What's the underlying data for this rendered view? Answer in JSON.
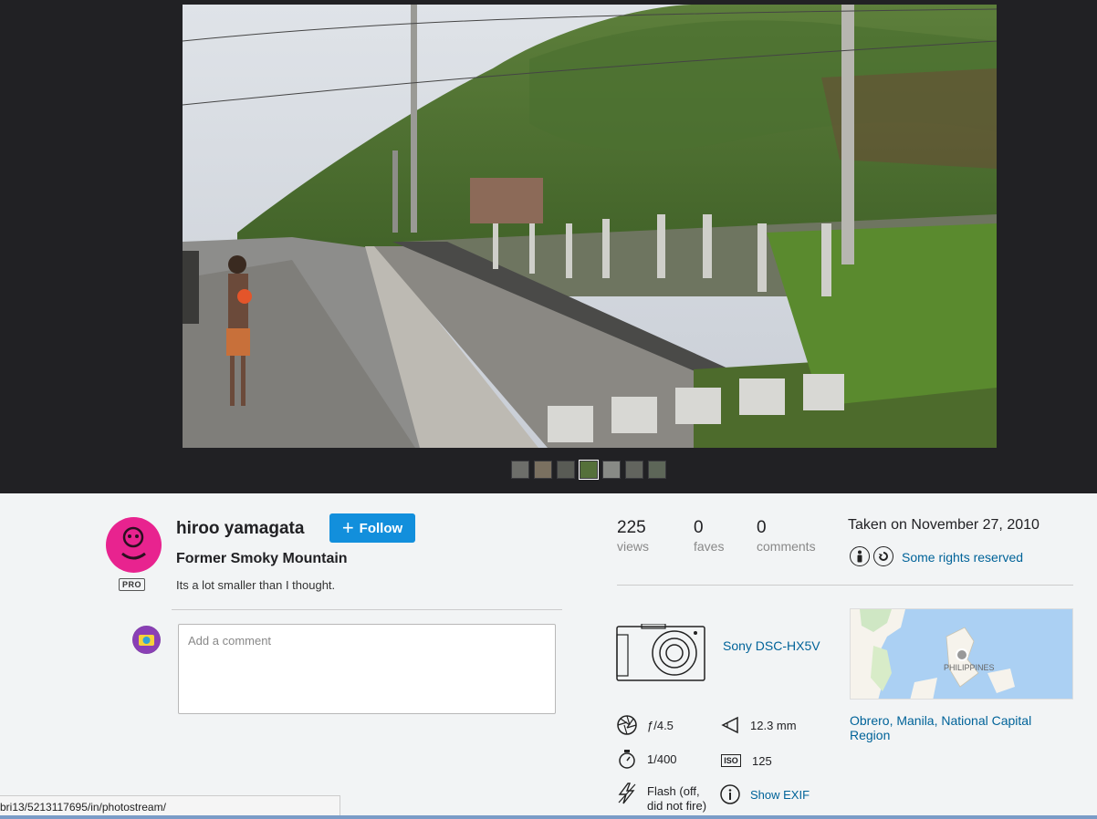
{
  "photo_viewer": {
    "thumbnails": [
      "thumb-1",
      "thumb-2",
      "thumb-3",
      "thumb-4",
      "thumb-5",
      "thumb-6",
      "thumb-7"
    ],
    "active_thumb": 3
  },
  "owner": {
    "name": "hiroo yamagata",
    "badge": "PRO",
    "follow_label": "Follow"
  },
  "photo": {
    "title": "Former Smoky Mountain",
    "description": "Its a lot smaller than I thought."
  },
  "comment": {
    "placeholder": "Add a comment"
  },
  "stats": {
    "views": {
      "count": "225",
      "label": "views"
    },
    "faves": {
      "count": "0",
      "label": "faves"
    },
    "comments": {
      "count": "0",
      "label": "comments"
    }
  },
  "taken": "Taken on November 27, 2010",
  "license": {
    "text": "Some rights reserved"
  },
  "camera": {
    "model": "Sony DSC-HX5V"
  },
  "map": {
    "country_label": "PHILIPPINES"
  },
  "location": "Obrero, Manila, National Capital Region",
  "exif": {
    "aperture": "ƒ/4.5",
    "focal_length": "12.3 mm",
    "shutter": "1/400",
    "iso": "125",
    "iso_label": "ISO",
    "flash": "Flash (off, did not fire)",
    "show_exif": "Show EXIF"
  },
  "status_url": "bri13/5213117695/in/photostream/",
  "colors": {
    "accent": "#128fdc",
    "link": "#006399",
    "stage": "#212124"
  }
}
